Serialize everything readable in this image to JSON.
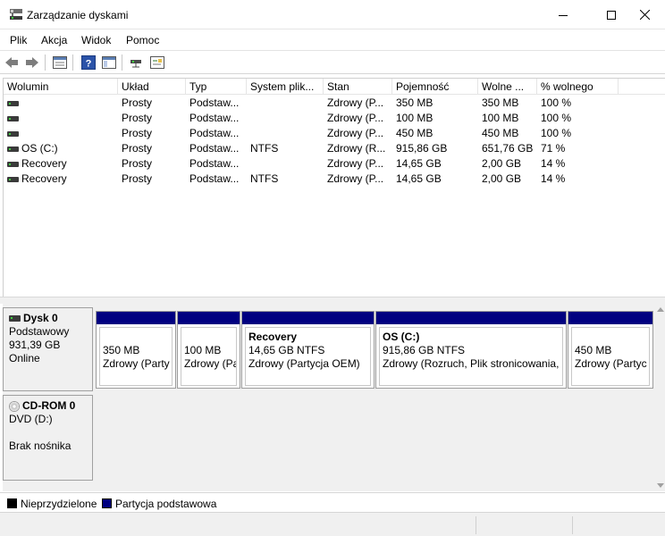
{
  "window": {
    "title": "Zarządzanie dyskami",
    "controls": [
      "minimize",
      "maximize",
      "close"
    ]
  },
  "menu": [
    "Plik",
    "Akcja",
    "Widok",
    "Pomoc"
  ],
  "toolbar": {
    "icons": [
      "back-arrow-icon",
      "forward-arrow-icon",
      "properties-icon",
      "help-icon",
      "console-view-icon",
      "connect-drive-icon",
      "settings-panel-icon"
    ]
  },
  "volumes": {
    "columns": [
      "Wolumin",
      "Układ",
      "Typ",
      "System plik...",
      "Stan",
      "Pojemność",
      "Wolne ...",
      "% wolnego"
    ],
    "rows": [
      [
        "",
        "Prosty",
        "Podstaw...",
        "",
        "Zdrowy (P...",
        "350 MB",
        "350 MB",
        "100 %"
      ],
      [
        "",
        "Prosty",
        "Podstaw...",
        "",
        "Zdrowy (P...",
        "100 MB",
        "100 MB",
        "100 %"
      ],
      [
        "",
        "Prosty",
        "Podstaw...",
        "",
        "Zdrowy (P...",
        "450 MB",
        "450 MB",
        "100 %"
      ],
      [
        "OS (C:)",
        "Prosty",
        "Podstaw...",
        "NTFS",
        "Zdrowy (R...",
        "915,86 GB",
        "651,76 GB",
        "71 %"
      ],
      [
        "Recovery",
        "Prosty",
        "Podstaw...",
        "",
        "Zdrowy (P...",
        "14,65 GB",
        "2,00 GB",
        "14 %"
      ],
      [
        "Recovery",
        "Prosty",
        "Podstaw...",
        "NTFS",
        "Zdrowy (P...",
        "14,65 GB",
        "2,00 GB",
        "14 %"
      ]
    ]
  },
  "disk0": {
    "name": "Dysk 0",
    "type": "Podstawowy",
    "size": "931,39 GB",
    "status": "Online",
    "partitions": [
      {
        "name": "",
        "size": "350 MB",
        "status": "Zdrowy (Party"
      },
      {
        "name": "",
        "size": "100 MB",
        "status": "Zdrowy (Pa"
      },
      {
        "name": "Recovery",
        "size": "14,65 GB NTFS",
        "status": "Zdrowy (Partycja OEM)"
      },
      {
        "name": "OS  (C:)",
        "size": "915,86 GB NTFS",
        "status": "Zdrowy (Rozruch, Plik stronicowania, z"
      },
      {
        "name": "",
        "size": "450 MB",
        "status": "Zdrowy (Partyc"
      }
    ]
  },
  "cdrom0": {
    "name": "CD-ROM 0",
    "drive": "DVD (D:)",
    "status": "Brak nośnika"
  },
  "legend": {
    "unallocated": "Nieprzydzielone",
    "primary": "Partycja podstawowa",
    "unallocated_color": "#000000",
    "primary_color": "#000080"
  }
}
